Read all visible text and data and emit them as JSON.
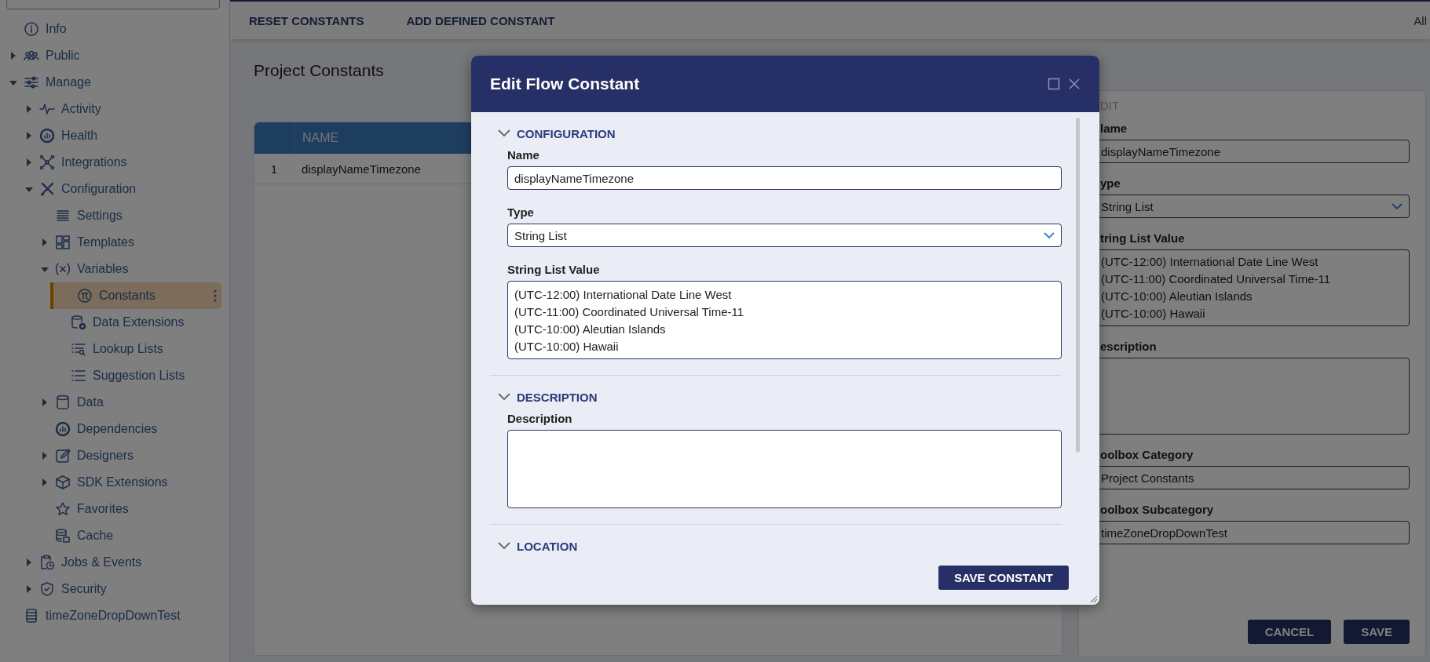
{
  "sidebar": {
    "items": [
      {
        "label": "Info",
        "selected": false
      },
      {
        "label": "Public",
        "selected": false,
        "expanded": false
      },
      {
        "label": "Manage",
        "selected": false,
        "expanded": true,
        "children": [
          {
            "label": "Activity",
            "selected": false,
            "expanded": false
          },
          {
            "label": "Health",
            "selected": false,
            "expanded": false
          },
          {
            "label": "Integrations",
            "selected": false,
            "expanded": false
          },
          {
            "label": "Configuration",
            "selected": false,
            "expanded": true,
            "children": [
              {
                "label": "Settings",
                "selected": false
              },
              {
                "label": "Templates",
                "selected": false,
                "expanded": false
              },
              {
                "label": "Variables",
                "selected": false,
                "expanded": true,
                "children": [
                  {
                    "label": "Constants",
                    "selected": true
                  },
                  {
                    "label": "Data Extensions",
                    "selected": false
                  },
                  {
                    "label": "Lookup Lists",
                    "selected": false
                  },
                  {
                    "label": "Suggestion Lists",
                    "selected": false
                  }
                ]
              },
              {
                "label": "Data",
                "selected": false,
                "expanded": false
              },
              {
                "label": "Dependencies",
                "selected": false
              },
              {
                "label": "Designers",
                "selected": false,
                "expanded": false
              },
              {
                "label": "SDK Extensions",
                "selected": false,
                "expanded": false
              },
              {
                "label": "Favorites",
                "selected": false
              },
              {
                "label": "Cache",
                "selected": false
              }
            ]
          },
          {
            "label": "Jobs & Events",
            "selected": false,
            "expanded": false
          },
          {
            "label": "Security",
            "selected": false,
            "expanded": false
          }
        ]
      },
      {
        "label": "timeZoneDropDownTest",
        "selected": false
      }
    ]
  },
  "toolbar": {
    "buttons": [
      "RESET CONSTANTS",
      "ADD DEFINED CONSTANT"
    ],
    "filter": "All"
  },
  "page": {
    "title": "Project Constants"
  },
  "table": {
    "columns": [
      "NAME"
    ],
    "rows": [
      {
        "index": "1",
        "name": "displayNameTimezone"
      }
    ]
  },
  "edit_panel": {
    "title": "DIT",
    "fields": [
      {
        "kind": "text",
        "label": "lame",
        "value": "displayNameTimezone"
      },
      {
        "kind": "select",
        "label": "ype",
        "value": "String List"
      },
      {
        "kind": "textarea",
        "label": "tring List Value",
        "lines": [
          "(UTC-12:00) International Date Line West",
          "(UTC-11:00) Coordinated Universal Time-11",
          "(UTC-10:00) Aleutian Islands",
          "(UTC-10:00) Hawaii"
        ]
      },
      {
        "kind": "textarea",
        "label": "escription"
      },
      {
        "kind": "text",
        "label": "oolbox Category",
        "value": "Project Constants"
      },
      {
        "kind": "text",
        "label": "oolbox Subcategory",
        "value": "timeZoneDropDownTest"
      }
    ],
    "buttons": [
      "CANCEL",
      "SAVE"
    ]
  },
  "modal": {
    "title": "Edit Flow Constant",
    "sections": [
      {
        "title": "CONFIGURATION",
        "fields": [
          {
            "kind": "text",
            "label": "Name",
            "value": "displayNameTimezone"
          },
          {
            "kind": "select",
            "label": "Type",
            "value": "String List"
          },
          {
            "kind": "textarea",
            "label": "String List Value",
            "lines": [
              "(UTC-12:00) International Date Line West",
              "(UTC-11:00) Coordinated Universal Time-11",
              "(UTC-10:00) Aleutian Islands",
              "(UTC-10:00) Hawaii"
            ]
          }
        ]
      },
      {
        "title": "DESCRIPTION",
        "fields": [
          {
            "kind": "textarea",
            "label": "Description"
          }
        ]
      },
      {
        "title": "LOCATION"
      }
    ],
    "button": "SAVE CONSTANT"
  }
}
